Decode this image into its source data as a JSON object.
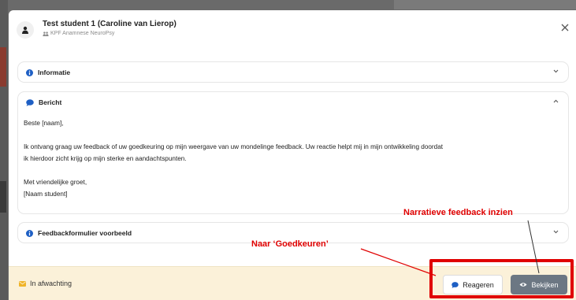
{
  "header": {
    "student_name": "Test student 1 (Caroline van Lierop)",
    "subtitle": "KPF Anamnese NeuroPsy"
  },
  "sections": [
    {
      "title": "Informatie",
      "icon": "info-icon",
      "expanded": false
    },
    {
      "title": "Bericht",
      "icon": "chat-bubble-icon",
      "expanded": true
    },
    {
      "title": "Feedbackformulier voorbeeld",
      "icon": "info-icon",
      "expanded": false
    }
  ],
  "message": {
    "greeting": "Beste [naam],",
    "line1": "Ik ontvang graag uw feedback of uw goedkeuring op mijn weergave van uw mondelinge feedback. Uw reactie helpt mij in mijn ontwikkeling doordat",
    "line2": "ik hierdoor zicht krijg op mijn sterke en aandachtspunten.",
    "closing": "Met vriendelijke groet,",
    "signature": "[Naam student]"
  },
  "footer": {
    "status": "In afwachting",
    "react_label": "Reageren",
    "view_label": "Bekijken"
  },
  "annotations": {
    "narrative": "Narratieve feedback inzien",
    "approve": "Naar ‘Goedkeuren’"
  },
  "colors": {
    "accent_blue": "#1e5fc4",
    "footer_bg": "#fbf1d9",
    "status_yellow": "#f0b429",
    "view_button": "#6c7783",
    "annotation_red": "#e00000"
  }
}
